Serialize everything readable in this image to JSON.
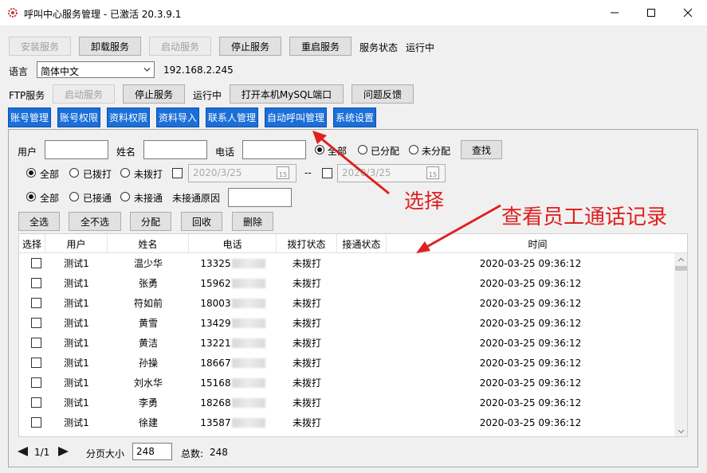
{
  "window": {
    "title": "呼叫中心服务管理 - 已激活  20.3.9.1",
    "min_icon": "minimize-icon",
    "max_icon": "maximize-icon",
    "close_icon": "close-icon"
  },
  "service": {
    "install": "安装服务",
    "uninstall": "卸载服务",
    "start": "启动服务",
    "stop": "停止服务",
    "restart": "重启服务",
    "status_label": "服务状态",
    "status_value": "运行中"
  },
  "language": {
    "label": "语言",
    "selected": "简体中文",
    "ip": "192.168.2.245"
  },
  "ftp": {
    "label": "FTP服务",
    "start": "启动服务",
    "stop": "停止服务",
    "status": "运行中",
    "open_mysql": "打开本机MySQL端口",
    "feedback": "问题反馈"
  },
  "tabs": [
    "账号管理",
    "账号权限",
    "资料权限",
    "资料导入",
    "联系人管理",
    "自动呼叫管理",
    "系统设置"
  ],
  "filters": {
    "user_label": "用户",
    "name_label": "姓名",
    "phone_label": "电话",
    "assign_all": "全部",
    "assign_assigned": "已分配",
    "assign_unassigned": "未分配",
    "search": "查找",
    "dial_all": "全部",
    "dial_dialed": "已拨打",
    "dial_undialed": "未拨打",
    "date_from": "2020/3/25",
    "date_sep": "--",
    "date_to": "2020/3/25",
    "conn_all": "全部",
    "conn_connected": "已接通",
    "conn_unconnected": "未接通",
    "unconnected_reason_label": "未接通原因"
  },
  "actions": {
    "select_all": "全选",
    "select_none": "全不选",
    "assign": "分配",
    "recycle": "回收",
    "delete": "删除"
  },
  "table": {
    "headers": [
      "选择",
      "用户",
      "姓名",
      "电话",
      "拨打状态",
      "接通状态",
      "时间"
    ],
    "rows": [
      {
        "user": "测试1",
        "name": "温少华",
        "phone": "13325",
        "dial": "未拨打",
        "conn": "",
        "time": "2020-03-25 09:36:12"
      },
      {
        "user": "测试1",
        "name": "张勇",
        "phone": "15962",
        "dial": "未拨打",
        "conn": "",
        "time": "2020-03-25 09:36:12"
      },
      {
        "user": "测试1",
        "name": "符如前",
        "phone": "18003",
        "dial": "未拨打",
        "conn": "",
        "time": "2020-03-25 09:36:12"
      },
      {
        "user": "测试1",
        "name": "黄雪",
        "phone": "13429",
        "dial": "未拨打",
        "conn": "",
        "time": "2020-03-25 09:36:12"
      },
      {
        "user": "测试1",
        "name": "黄洁",
        "phone": "13221",
        "dial": "未拨打",
        "conn": "",
        "time": "2020-03-25 09:36:12"
      },
      {
        "user": "测试1",
        "name": "孙操",
        "phone": "18667",
        "dial": "未拨打",
        "conn": "",
        "time": "2020-03-25 09:36:12"
      },
      {
        "user": "测试1",
        "name": "刘水华",
        "phone": "15168",
        "dial": "未拨打",
        "conn": "",
        "time": "2020-03-25 09:36:12"
      },
      {
        "user": "测试1",
        "name": "李勇",
        "phone": "18268",
        "dial": "未拨打",
        "conn": "",
        "time": "2020-03-25 09:36:12"
      },
      {
        "user": "测试1",
        "name": "徐建",
        "phone": "13587",
        "dial": "未拨打",
        "conn": "",
        "time": "2020-03-25 09:36:12"
      }
    ]
  },
  "pager": {
    "page": "1/1",
    "page_size_label": "分页大小",
    "page_size": "248",
    "total_label": "总数:",
    "total": "248"
  },
  "annotations": {
    "select": "选择",
    "view_records": "查看员工通话记录"
  },
  "colors": {
    "tab_blue": "#1b6fd8",
    "annotation_red": "#e02020"
  }
}
